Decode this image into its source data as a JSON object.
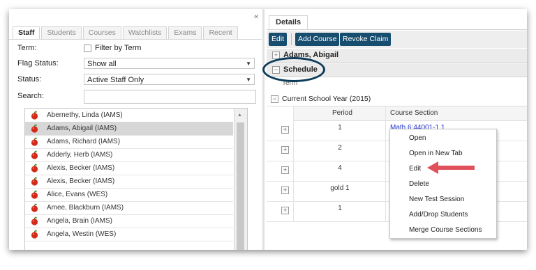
{
  "left": {
    "tabs": [
      "Staff",
      "Students",
      "Courses",
      "Watchlists",
      "Exams",
      "Recent"
    ],
    "collapse_glyph": "«",
    "term_label": "Term:",
    "filter_by_term": "Filter by Term",
    "flag_status_label": "Flag Status:",
    "flag_status_value": "Show all",
    "status_label": "Status:",
    "status_value": "Active Staff Only",
    "search_label": "Search:",
    "search_value": "",
    "staff": [
      "Abernethy, Linda (IAMS)",
      "Adams, Abigail (IAMS)",
      "Adams, Richard (IAMS)",
      "Adderly, Herb (IAMS)",
      "Alexis, Becker (IAMS)",
      "Alexis, Becker (IAMS)",
      "Alice, Evans (WES)",
      "Amee, Blackburn (IAMS)",
      "Angela, Brain (IAMS)",
      "Angela, Westin (WES)"
    ],
    "selected_index": 1
  },
  "right": {
    "details_tab": "Details",
    "toolbar": {
      "edit": "Edit",
      "add_course": "Add Course",
      "revoke_claim": "Revoke Claim"
    },
    "person": "Adams, Abigail",
    "schedule": "Schedule",
    "term_header": "Term",
    "year": "Current School Year (2015)",
    "columns": {
      "period": "Period",
      "course_section": "Course Section"
    },
    "rows": [
      {
        "period": "1",
        "course": "Math 6:44001-1 1"
      },
      {
        "period": "2",
        "course": ""
      },
      {
        "period": "4",
        "course": ""
      },
      {
        "period": "gold 1",
        "course": ""
      },
      {
        "period": "1",
        "course": ""
      }
    ]
  },
  "context_menu": [
    "Open",
    "Open in New Tab",
    "Edit",
    "Delete",
    "New Test Session",
    "Add/Drop Students",
    "Merge Course Sections"
  ],
  "colors": {
    "button": "#174e6f",
    "arrow": "#e0505a",
    "highlight_ring": "#0d3b5a",
    "link": "#2233cc"
  },
  "icons": {
    "staff_row": "apple-icon"
  }
}
